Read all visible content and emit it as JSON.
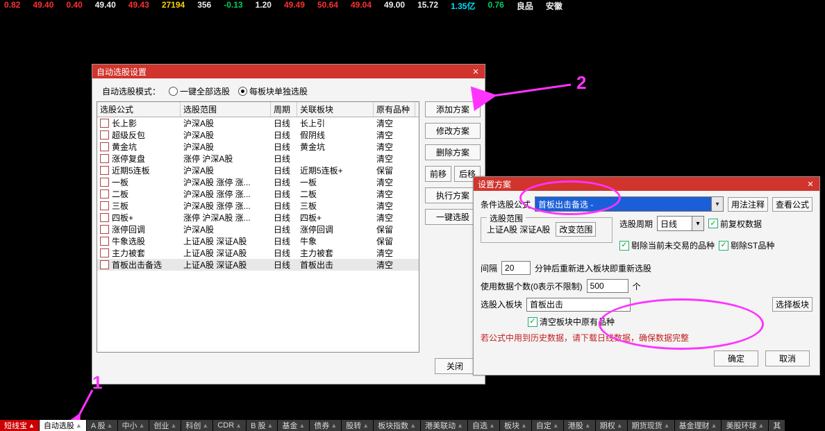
{
  "ticker": [
    {
      "text": "0.82",
      "cls": "tk-red"
    },
    {
      "text": "49.40",
      "cls": "tk-red"
    },
    {
      "text": "0.40",
      "cls": "tk-red"
    },
    {
      "text": "49.40",
      "cls": "tk-white"
    },
    {
      "text": "49.43",
      "cls": "tk-red"
    },
    {
      "text": "27194",
      "cls": "tk-yellow"
    },
    {
      "text": "356",
      "cls": "tk-white"
    },
    {
      "text": "-0.13",
      "cls": "tk-green"
    },
    {
      "text": "1.20",
      "cls": "tk-white"
    },
    {
      "text": "49.49",
      "cls": "tk-red"
    },
    {
      "text": "50.64",
      "cls": "tk-red"
    },
    {
      "text": "49.04",
      "cls": "tk-red"
    },
    {
      "text": "49.00",
      "cls": "tk-white"
    },
    {
      "text": "15.72",
      "cls": "tk-white"
    },
    {
      "text": "1.35亿",
      "cls": "tk-cyan"
    },
    {
      "text": "0.76",
      "cls": "tk-green"
    },
    {
      "text": "良品",
      "cls": "tk-white"
    },
    {
      "text": "安徽",
      "cls": "tk-white"
    }
  ],
  "dlg1": {
    "title": "自动选股设置",
    "mode_label": "自动选股模式：",
    "mode_opt1": "一键全部选股",
    "mode_opt2": "每板块单独选股",
    "headers": [
      "选股公式",
      "选股范围",
      "周期",
      "关联板块",
      "原有品种"
    ],
    "rows": [
      {
        "name": "长上影",
        "range": "沪深A股",
        "cycle": "日线",
        "block": "长上引",
        "orig": "清空"
      },
      {
        "name": "超级反包",
        "range": "沪深A股",
        "cycle": "日线",
        "block": "假阴线",
        "orig": "清空"
      },
      {
        "name": "黄金坑",
        "range": "沪深A股",
        "cycle": "日线",
        "block": "黄金坑",
        "orig": "清空"
      },
      {
        "name": "涨停复盘",
        "range": "涨停 沪深A股",
        "cycle": "日线",
        "block": "",
        "orig": "清空"
      },
      {
        "name": "近期5连板",
        "range": "沪深A股",
        "cycle": "日线",
        "block": "近期5连板+",
        "orig": "保留"
      },
      {
        "name": "一板",
        "range": "沪深A股 涨停 涨...",
        "cycle": "日线",
        "block": "一板",
        "orig": "清空"
      },
      {
        "name": "二板",
        "range": "沪深A股 涨停 涨...",
        "cycle": "日线",
        "block": "二板",
        "orig": "清空"
      },
      {
        "name": "三板",
        "range": "沪深A股 涨停 涨...",
        "cycle": "日线",
        "block": "三板",
        "orig": "清空"
      },
      {
        "name": "四板+",
        "range": "涨停 沪深A股 涨...",
        "cycle": "日线",
        "block": "四板+",
        "orig": "清空"
      },
      {
        "name": "涨停回调",
        "range": "沪深A股",
        "cycle": "日线",
        "block": "涨停回调",
        "orig": "保留"
      },
      {
        "name": "牛象选股",
        "range": "上证A股 深证A股",
        "cycle": "日线",
        "block": "牛象",
        "orig": "保留"
      },
      {
        "name": "主力被套",
        "range": "上证A股 深证A股",
        "cycle": "日线",
        "block": "主力被套",
        "orig": "清空"
      },
      {
        "name": "首板出击备选",
        "range": "上证A股 深证A股",
        "cycle": "日线",
        "block": "首板出击",
        "orig": "清空",
        "sel": true
      }
    ],
    "btns": {
      "add": "添加方案",
      "edit": "修改方案",
      "del": "删除方案",
      "prev": "前移",
      "next": "后移",
      "exec": "执行方案",
      "onekey": "一键选股"
    },
    "close_btn": "关闭"
  },
  "dlg2": {
    "title": "设置方案",
    "formula_label": "条件选股公式",
    "formula_value": "首板出击备选 -",
    "btn_usage": "用法注释",
    "btn_view": "查看公式",
    "range_legend": "选股范围",
    "range_text": "上证A股 深证A股",
    "btn_change_range": "改变范围",
    "cycle_label": "选股周期",
    "cycle_value": "日线",
    "chk_fq": "前复权数据",
    "chk_excl_notrade": "剔除当前未交易的品种",
    "chk_excl_st": "剔除ST品种",
    "interval_label": "间隔",
    "interval_value": "20",
    "interval_tail": "分钟后重新进入板块即重新选股",
    "datacount_label": "使用数据个数(0表示不限制)",
    "datacount_value": "500",
    "datacount_tail": "个",
    "intoblock_label": "选股入板块",
    "intoblock_value": "首板出击",
    "btn_pickblock": "选择板块",
    "chk_clear_orig": "清空板块中原有品种",
    "warn": "若公式中用到历史数据，请下载日线数据，确保数据完整",
    "ok": "确定",
    "cancel": "取消"
  },
  "annotations": {
    "n1": "1",
    "n2": "2"
  },
  "bottom_tabs": [
    {
      "label": "短线宝",
      "cls": "red",
      "tri": true
    },
    {
      "label": "自动选股",
      "cls": "white",
      "tri": true
    },
    {
      "label": "A 股",
      "cls": "grey",
      "tri": true
    },
    {
      "label": "中小",
      "cls": "grey",
      "tri": true
    },
    {
      "label": "创业",
      "cls": "grey",
      "tri": true
    },
    {
      "label": "科创",
      "cls": "grey",
      "tri": true
    },
    {
      "label": "CDR",
      "cls": "grey",
      "tri": true
    },
    {
      "label": "B 股",
      "cls": "grey",
      "tri": true
    },
    {
      "label": "基金",
      "cls": "grey",
      "tri": true
    },
    {
      "label": "债券",
      "cls": "grey",
      "tri": true
    },
    {
      "label": "股转",
      "cls": "grey",
      "tri": true
    },
    {
      "label": "板块指数",
      "cls": "grey",
      "tri": true
    },
    {
      "label": "港美联动",
      "cls": "grey",
      "tri": true
    },
    {
      "label": "自选",
      "cls": "grey",
      "tri": true
    },
    {
      "label": "板块",
      "cls": "grey",
      "tri": true
    },
    {
      "label": "自定",
      "cls": "grey",
      "tri": true
    },
    {
      "label": "港股",
      "cls": "grey",
      "tri": true
    },
    {
      "label": "期权",
      "cls": "grey",
      "tri": true
    },
    {
      "label": "期货现货",
      "cls": "grey",
      "tri": true
    },
    {
      "label": "基金理财",
      "cls": "grey",
      "tri": true
    },
    {
      "label": "美股环球",
      "cls": "grey",
      "tri": true
    },
    {
      "label": "其",
      "cls": "grey",
      "tri": false
    }
  ]
}
